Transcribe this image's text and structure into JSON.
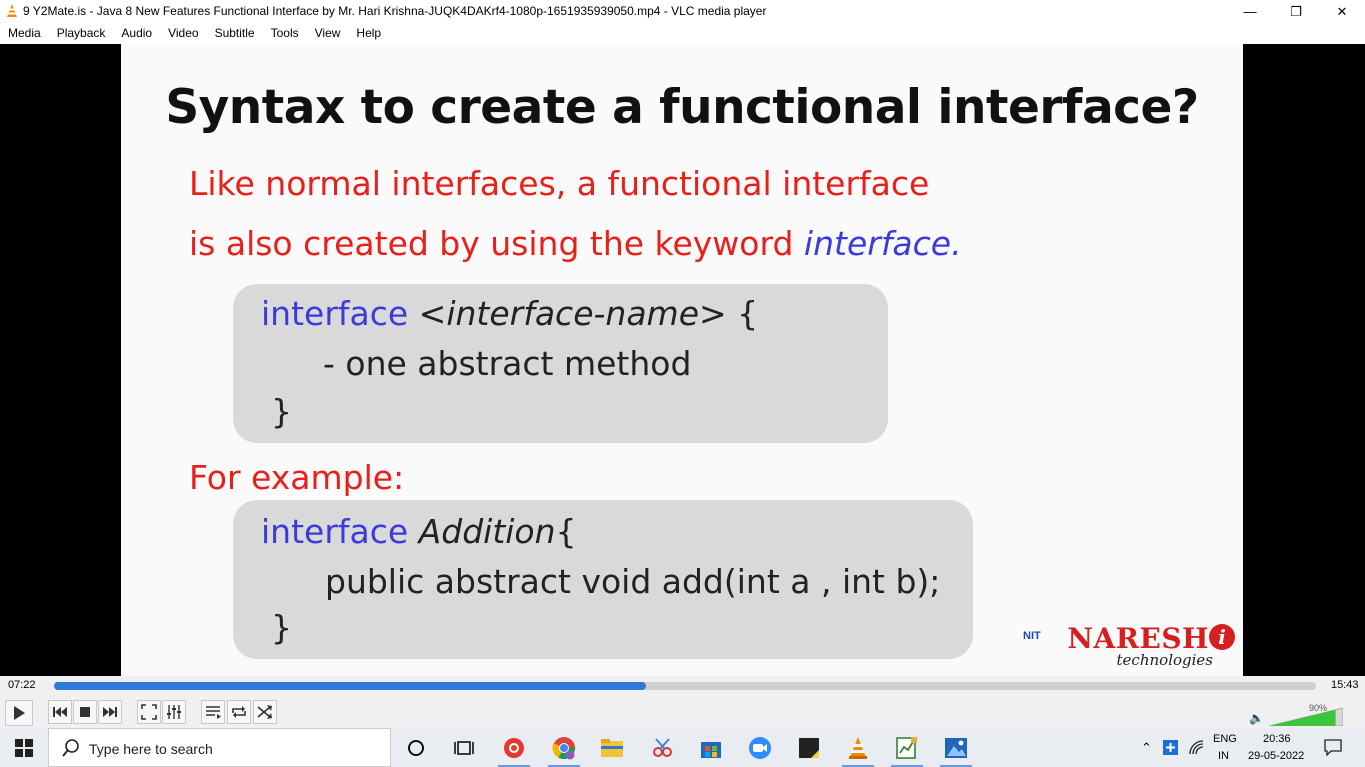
{
  "window": {
    "title": "9 Y2Mate.is - Java 8 New Features  Functional Interface  by Mr. Hari Krishna-JUQK4DAKrf4-1080p-1651935939050.mp4 - VLC media player",
    "minimize_glyph": "—",
    "maximize_glyph": "❐",
    "close_glyph": "✕"
  },
  "menu": [
    "Media",
    "Playback",
    "Audio",
    "Video",
    "Subtitle",
    "Tools",
    "View",
    "Help"
  ],
  "slide": {
    "title": "Syntax to create a functional interface?",
    "line1": "Like normal interfaces, a functional interface",
    "line2_text": "is also created by using the keyword ",
    "line2_keyword": "interface.",
    "box1": {
      "kw": "interface",
      "name": " <interface-name>",
      "brace_open": " {",
      "body": "- one abstract method",
      "brace_close": "}"
    },
    "example_label": "For example:",
    "box2": {
      "kw": "interface",
      "name": " Addition",
      "brace_open": "{",
      "body": "public abstract void add(int a , int b);",
      "brace_close": "}"
    },
    "logo": {
      "brand": "NARESH",
      "sub": "technologies",
      "mark": "NIT",
      "i": "i"
    }
  },
  "player": {
    "elapsed": "07:22",
    "total": "15:43",
    "progress_fraction": 0.469,
    "volume": "90%",
    "volume_fraction": 0.9
  },
  "taskbar": {
    "search_placeholder": "Type here to search",
    "lang": "ENG",
    "region": "IN",
    "time": "20:36",
    "date": "29-05-2022"
  }
}
